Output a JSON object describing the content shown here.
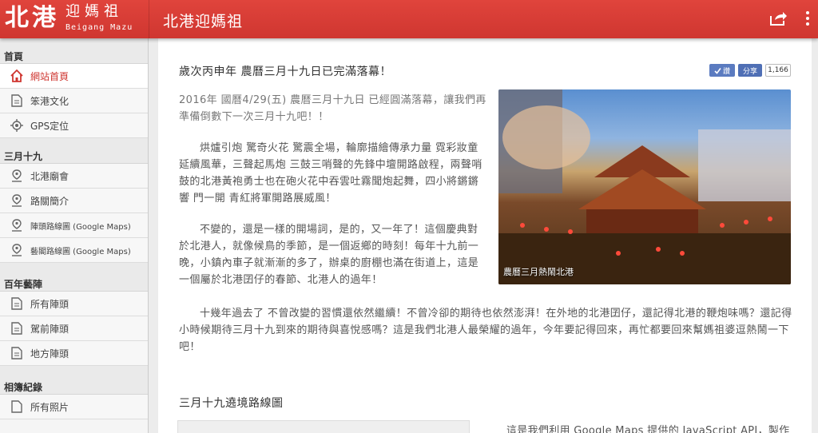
{
  "header": {
    "logo_main": "北港",
    "logo_sub": "迎媽祖",
    "logo_en": "Beigang Mazu",
    "title": "北港迎媽祖",
    "share_icon": "share-icon",
    "more_icon": "more-vert-icon",
    "brand_color": "#cf3630"
  },
  "sidebar": {
    "sections": [
      {
        "title": "首頁",
        "items": [
          {
            "label": "網站首頁",
            "icon": "home-icon",
            "active": true
          },
          {
            "label": "笨港文化",
            "icon": "document-icon"
          },
          {
            "label": "GPS定位",
            "icon": "gps-icon"
          }
        ]
      },
      {
        "title": "三月十九",
        "items": [
          {
            "label": "北港廟會",
            "icon": "map-pin-icon"
          },
          {
            "label": "路關簡介",
            "icon": "map-pin-icon"
          },
          {
            "label": "陣頭路線圖 (Google Maps)",
            "icon": "map-pin-icon"
          },
          {
            "label": "藝閣路線圖 (Google Maps)",
            "icon": "map-pin-icon"
          }
        ]
      },
      {
        "title": "百年藝陣",
        "items": [
          {
            "label": "所有陣頭",
            "icon": "document-icon"
          },
          {
            "label": "駕前陣頭",
            "icon": "document-icon"
          },
          {
            "label": "地方陣頭",
            "icon": "document-icon"
          }
        ]
      },
      {
        "title": "相簿紀錄",
        "items": [
          {
            "label": "所有照片",
            "icon": "document-icon"
          }
        ]
      }
    ]
  },
  "post": {
    "title": "歲次丙申年 農曆三月十九日已完滿落幕！",
    "fb_like": "讚",
    "fb_share": "分享",
    "fb_count": "1,166",
    "p1": "2016年 國曆4/29(五) 農曆三月十九日 已經圓滿落幕，讓我們再準備倒數下一次三月十九吧！！",
    "p2": "烘爐引炮 驚奇火花 驚震全場，輪廓描繪傳承力量 霓彩妝童延續風華，三聲起馬炮 三鼓三哨聲的先鋒中壇開路啟程，兩聲哨鼓的北港黃袍勇士也在砲火花中吞雲吐霧聞炮起舞，四小將鏘鏘響 門一開 青紅將軍開路展威風！",
    "p3": "不變的，還是一樣的開場詞，是的，又一年了！這個慶典對於北港人，就像候鳥的季節，是一個返鄉的時刻！每年十九前一晚，小鎮內車子就漸漸的多了，辦桌的廚棚也滿在街道上，這是一個屬於北港囝仔的春節、北港人的過年！",
    "p4": "十幾年過去了 不曾改變的習慣還依然繼續！不曾冷卻的期待也依然澎湃！在外地的北港囝仔，還記得北港的鞭炮味嗎？還記得小時候期待三月十九到來的期待與喜悅感嗎？這是我們北港人最榮耀的過年，今年要記得回來，再忙都要回來幫媽祖婆逗熱鬧一下吧！",
    "photo_caption": "農曆三月熱鬧北港",
    "subtitle": "三月十九遶境路線圖",
    "map_text": "這是我們利用 Google Maps 提供的 JavaScript API，製作"
  }
}
